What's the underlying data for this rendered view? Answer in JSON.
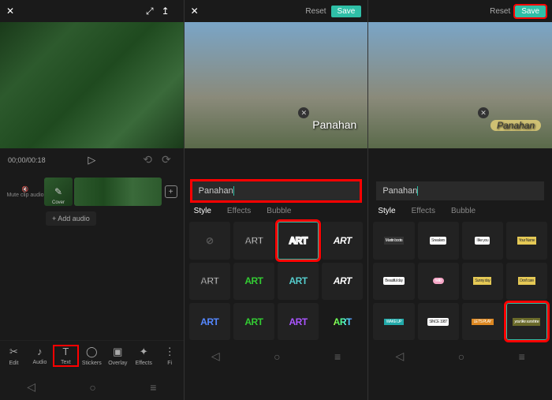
{
  "panel1": {
    "topbar": {
      "close": "✕",
      "expand": "⤢",
      "share": "↥"
    },
    "time": {
      "current": "00;00",
      "total": "00:18"
    },
    "play_icon": "▷",
    "undo_icon": "⟲",
    "redo_icon": "⟳",
    "mute_icon": "🔇",
    "mute_label": "Mute clip audio",
    "cover_icon": "✎",
    "cover_label": "Cover",
    "add_icon": "+",
    "add_audio": "+ Add audio",
    "tools": [
      {
        "icon": "✂",
        "label": "Edit"
      },
      {
        "icon": "♪",
        "label": "Audio"
      },
      {
        "icon": "T",
        "label": "Text"
      },
      {
        "icon": "◯",
        "label": "Stickers"
      },
      {
        "icon": "▣",
        "label": "Overlay"
      },
      {
        "icon": "✦",
        "label": "Effects"
      },
      {
        "icon": "⋮",
        "label": "Fi"
      }
    ]
  },
  "panel2": {
    "reset": "Reset",
    "save": "Save",
    "close": "✕",
    "input_value": "Panahan",
    "caption": "Panahan",
    "close_caption": "✕",
    "tabs": {
      "style": "Style",
      "effects": "Effects",
      "bubble": "Bubble"
    },
    "none_icon": "⊘",
    "art_label": "ART"
  },
  "panel3": {
    "reset": "Reset",
    "save": "Save",
    "input_value": "Panahan",
    "caption": "Panahan",
    "close_caption": "✕",
    "tabs": {
      "style": "Style",
      "effects": "Effects",
      "bubble": "Bubble"
    },
    "bubble_labels": {
      "b1": "Martin boots",
      "b2": "Sneakers",
      "b3": "I like you",
      "b4": "Your Name",
      "b5": "Beautiful day",
      "b6": "hello",
      "b7": "Sunny day",
      "b8": "Don't care",
      "b9": "WAKE UP",
      "b10": "SINCE 1987",
      "b11": "LET'S PLAY",
      "b12": "your like sunshine"
    }
  },
  "nav": {
    "back": "◁",
    "home": "○",
    "recent": "≡"
  }
}
